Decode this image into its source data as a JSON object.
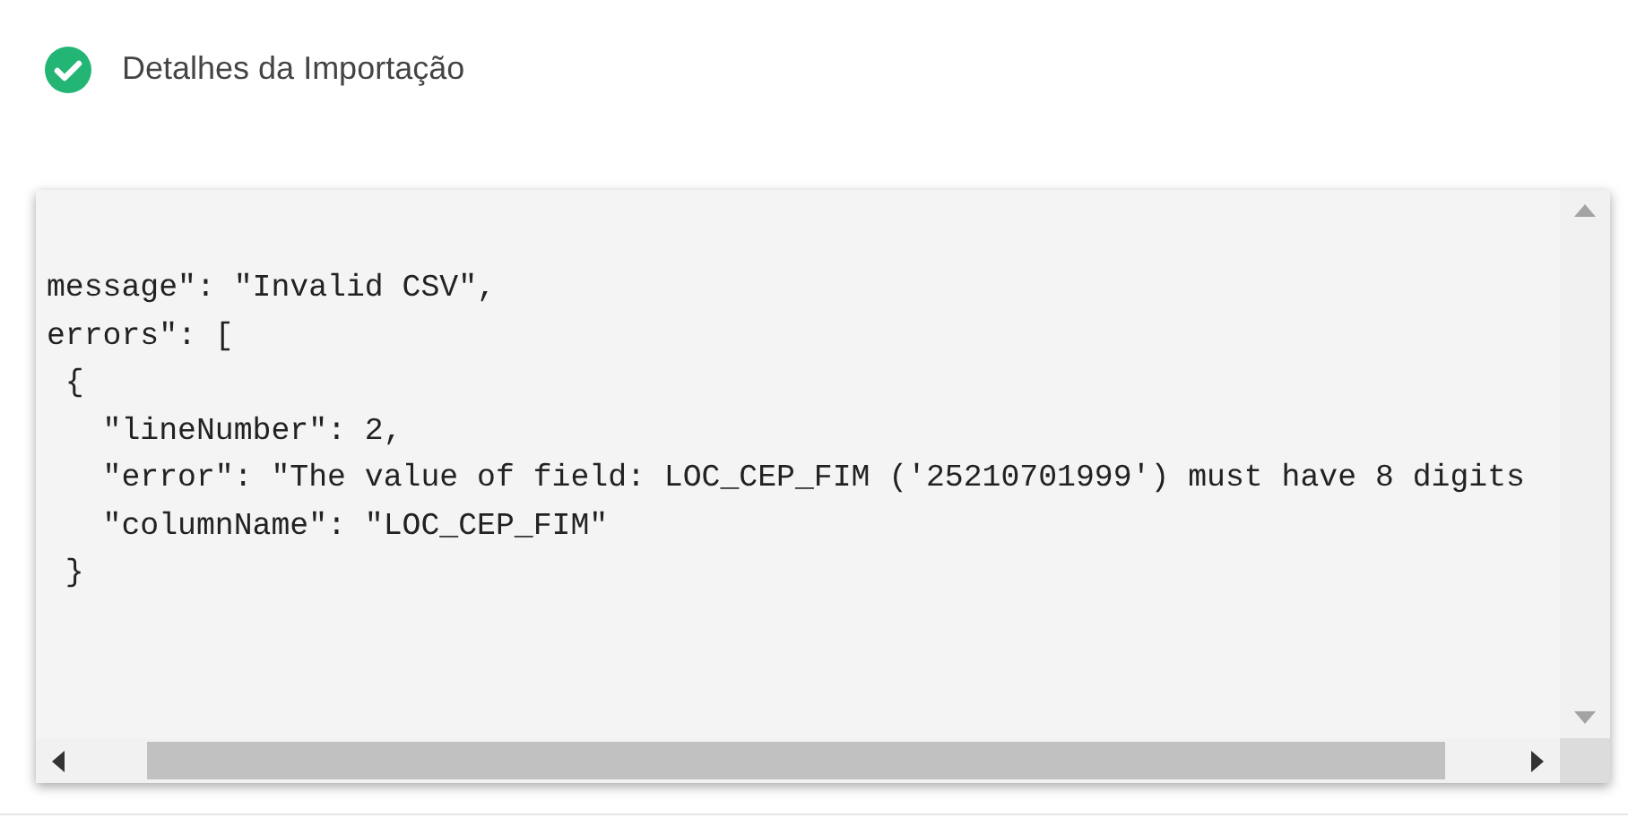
{
  "header": {
    "title": "Detalhes da Importação"
  },
  "code_lines": [
    "message\": \"Invalid CSV\",",
    "errors\": [",
    " {",
    "   \"lineNumber\": 2,",
    "   \"error\": \"The value of field: LOC_CEP_FIM ('25210701999') must have 8 digits",
    "   \"columnName\": \"LOC_CEP_FIM\"",
    " }"
  ]
}
